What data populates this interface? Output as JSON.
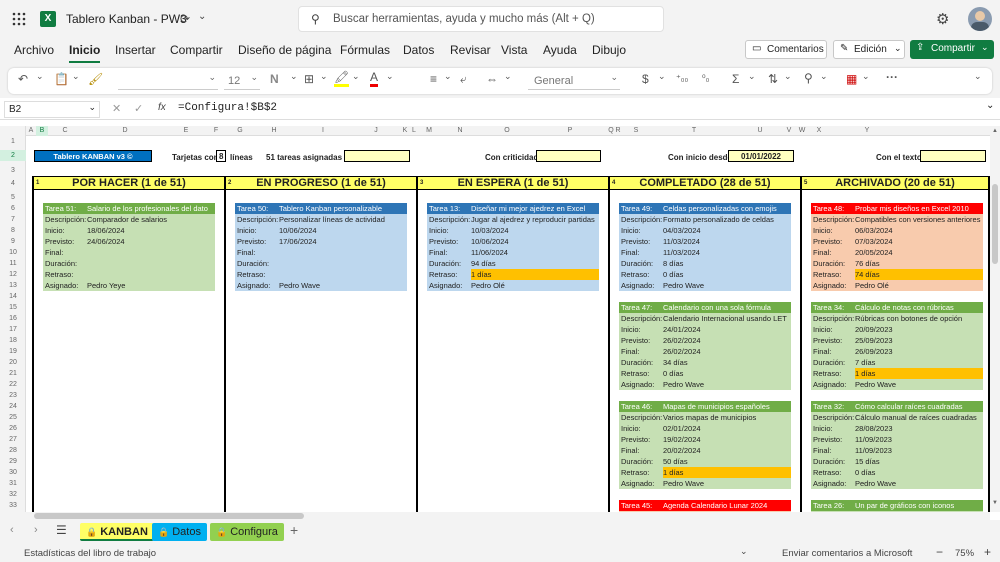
{
  "app": {
    "title": "Tablero Kanban - PW3",
    "search_placeholder": "Buscar herramientas, ayuda y mucho más (Alt + Q)"
  },
  "menu": [
    "Archivo",
    "Inicio",
    "Insertar",
    "Compartir",
    "Diseño de página",
    "Fórmulas",
    "Datos",
    "Revisar",
    "Vista",
    "Ayuda",
    "Dibujo"
  ],
  "actions": {
    "comments": "Comentarios",
    "editing": "Edición",
    "share": "Compartir"
  },
  "ribbon": {
    "font_size": "12",
    "number_format": "General"
  },
  "formula": {
    "name_box": "B2",
    "fx": "fx",
    "content": "=Configura!$B$2"
  },
  "columns": [
    "A",
    "B",
    "C",
    "D",
    "E",
    "F",
    "G",
    "H",
    "I",
    "J",
    "K",
    "L",
    "M",
    "N",
    "O",
    "P",
    "Q",
    "R",
    "S",
    "T",
    "U",
    "V",
    "W",
    "X",
    "Y"
  ],
  "rows": [
    "1",
    "2",
    "3",
    "4",
    "5",
    "6",
    "7",
    "8",
    "9",
    "10",
    "11",
    "12",
    "13",
    "14",
    "15",
    "16",
    "17",
    "18",
    "19",
    "20",
    "21",
    "22",
    "23",
    "24",
    "25",
    "26",
    "27",
    "28",
    "29",
    "30",
    "31",
    "32",
    "33"
  ],
  "header": {
    "title": "Tablero KANBAN v3 ©",
    "tarjetas_con": "Tarjetas con",
    "tarjetas_value": "8",
    "lineas": "líneas",
    "tareas_asignadas": "51 tareas asignadas a",
    "con_criticidad": "Con criticidad",
    "con_inicio_desde": "Con inicio desde",
    "inicio_value": "01/01/2022",
    "con_el_texto": "Con el texto"
  },
  "lanes": [
    {
      "num": "1",
      "title": "POR HACER (1 de 51)"
    },
    {
      "num": "2",
      "title": "EN PROGRESO (1 de 51)"
    },
    {
      "num": "3",
      "title": "EN ESPERA (1 de 51)"
    },
    {
      "num": "4",
      "title": "COMPLETADO (28 de 51)"
    },
    {
      "num": "5",
      "title": "ARCHIVADO (20 de 51)"
    }
  ],
  "field_labels": [
    "Descripción:",
    "Inicio:",
    "Previsto:",
    "Final:",
    "Duración:",
    "Retraso:",
    "Asignado:"
  ],
  "cards": [
    {
      "lane": 0,
      "slot": 0,
      "head_color": "#70ad47",
      "body_color": "#c6e0b4",
      "id": "Tarea 51:",
      "name": "Salario de los profesionales del dato",
      "fields": [
        "Comparador de salarios",
        "18/06/2024",
        "24/06/2024",
        "",
        "",
        "",
        "Pedro Yeye"
      ],
      "retraso_color": ""
    },
    {
      "lane": 1,
      "slot": 0,
      "head_color": "#2e75b6",
      "body_color": "#bdd7ee",
      "id": "Tarea 50:",
      "name": "Tablero Kanban personalizable",
      "fields": [
        "Personalizar líneas de actividad",
        "10/06/2024",
        "17/06/2024",
        "",
        "",
        "",
        "Pedro Wave"
      ],
      "retraso_color": ""
    },
    {
      "lane": 2,
      "slot": 0,
      "head_color": "#2e75b6",
      "body_color": "#bdd7ee",
      "id": "Tarea 13:",
      "name": "Diseñar mi mejor ajedrez en Excel",
      "fields": [
        "Jugar al ajedrez y reproducir partidas",
        "10/03/2024",
        "10/06/2024",
        "11/06/2024",
        "94 días",
        "1 días",
        "Pedro Olé"
      ],
      "retraso_color": "#ffc000"
    },
    {
      "lane": 3,
      "slot": 0,
      "head_color": "#2e75b6",
      "body_color": "#bdd7ee",
      "id": "Tarea 49:",
      "name": "Celdas personalizadas con emojis",
      "fields": [
        "Formato personalizado de celdas",
        "04/03/2024",
        "11/03/2024",
        "11/03/2024",
        "8 días",
        "0 días",
        "Pedro Wave"
      ],
      "retraso_color": ""
    },
    {
      "lane": 3,
      "slot": 1,
      "head_color": "#70ad47",
      "body_color": "#c6e0b4",
      "id": "Tarea 47:",
      "name": "Calendario con una sola fórmula",
      "fields": [
        "Calendario Internacional usando LET",
        "24/01/2024",
        "26/02/2024",
        "26/02/2024",
        "34 días",
        "0 días",
        "Pedro Wave"
      ],
      "retraso_color": ""
    },
    {
      "lane": 3,
      "slot": 2,
      "head_color": "#70ad47",
      "body_color": "#c6e0b4",
      "id": "Tarea 46:",
      "name": "Mapas de municipios españoles",
      "fields": [
        "Varios mapas de municipios",
        "02/01/2024",
        "19/02/2024",
        "20/02/2024",
        "50 días",
        "1 días",
        "Pedro Wave"
      ],
      "retraso_color": "#ffc000"
    },
    {
      "lane": 3,
      "slot": 3,
      "head_color": "#ff0000",
      "body_color": "#f8cbad",
      "id": "Tarea 45:",
      "name": "Agenda Calendario Lunar 2024",
      "fields": [
        "",
        "",
        "",
        "",
        "",
        "",
        ""
      ],
      "retraso_color": ""
    },
    {
      "lane": 4,
      "slot": 0,
      "head_color": "#ff0000",
      "body_color": "#f8cbad",
      "id": "Tarea 48:",
      "name": "Probar mis diseños en Excel 2010",
      "fields": [
        "Compatibles con versiones anteriores",
        "06/03/2024",
        "07/03/2024",
        "20/05/2024",
        "76 días",
        "74 días",
        "Pedro Olé"
      ],
      "retraso_color": "#ffc000"
    },
    {
      "lane": 4,
      "slot": 1,
      "head_color": "#70ad47",
      "body_color": "#c6e0b4",
      "id": "Tarea 34:",
      "name": "Cálculo de notas con rúbricas",
      "fields": [
        "Rúbricas con botones de opción",
        "20/09/2023",
        "25/09/2023",
        "26/09/2023",
        "7 días",
        "1 días",
        "Pedro Wave"
      ],
      "retraso_color": "#ffc000"
    },
    {
      "lane": 4,
      "slot": 2,
      "head_color": "#70ad47",
      "body_color": "#c6e0b4",
      "id": "Tarea 32:",
      "name": "Cómo calcular raíces cuadradas",
      "fields": [
        "Cálculo manual de raíces cuadradas",
        "28/08/2023",
        "11/09/2023",
        "11/09/2023",
        "15 días",
        "0 días",
        "Pedro Wave"
      ],
      "retraso_color": ""
    },
    {
      "lane": 4,
      "slot": 3,
      "head_color": "#70ad47",
      "body_color": "#c6e0b4",
      "id": "Tarea 26:",
      "name": "Un par de gráficos con iconos",
      "fields": [
        "",
        "",
        "",
        "",
        "",
        "",
        ""
      ],
      "retraso_color": ""
    }
  ],
  "sheets": [
    {
      "name": "KANBAN",
      "color": "#ffff66"
    },
    {
      "name": "Datos",
      "color": "#00b0f0"
    },
    {
      "name": "Configura",
      "color": "#92d050"
    }
  ],
  "status": {
    "left": "Estadísticas del libro de trabajo",
    "feedback": "Enviar comentarios a Microsoft",
    "zoom": "75%"
  }
}
